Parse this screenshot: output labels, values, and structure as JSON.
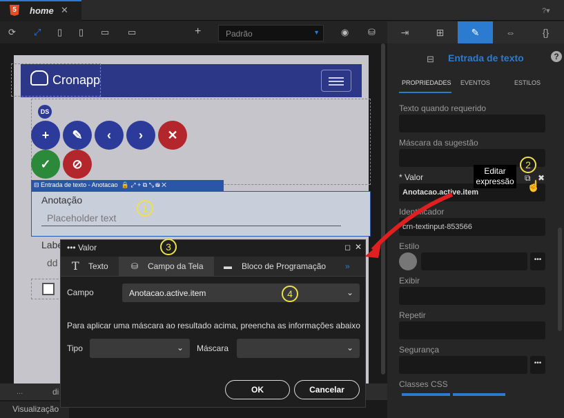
{
  "tab": {
    "title": "home",
    "close": "✕"
  },
  "toolbar": {
    "preset": "Padrão"
  },
  "canvas": {
    "logo_text": "Cronapp",
    "ds_badge": "DS",
    "selected_label": "Entrada de texto - Anotacao",
    "field_label": "Anotação",
    "placeholder": "Placeholder text",
    "bg_label_fragment": "Labe",
    "bg_input_fragment": "dd"
  },
  "bottom": {
    "left": "...",
    "fragment": "di",
    "visualizacao": "Visualização"
  },
  "panel": {
    "title": "Entrada de texto",
    "subtabs": [
      "PROPRIEDADES",
      "EVENTOS",
      "ESTILOS"
    ],
    "fields": {
      "texto_requerido": "Texto quando requerido",
      "mascara_sugestao": "Máscara da sugestão",
      "valor": "* Valor",
      "valor_value": "Anotacao.active.item",
      "identificador": "Identificador",
      "identificador_value": "crn-textinput-853566",
      "estilo": "Estilo",
      "exibir": "Exibir",
      "repetir": "Repetir",
      "seguranca": "Segurança",
      "classes_css": "Classes CSS"
    },
    "tooltip": "Editar expressão"
  },
  "dialog": {
    "title": "Valor",
    "tabs": [
      "Texto",
      "Campo da Tela",
      "Bloco de Programação"
    ],
    "more": "»",
    "campo_label": "Campo",
    "campo_value": "Anotacao.active.item",
    "info": "Para aplicar uma máscara ao resultado acima, preencha as informações abaixo",
    "tipo_label": "Tipo",
    "mascara_label": "Máscara",
    "ok": "OK",
    "cancel": "Cancelar"
  },
  "annotations": [
    "1",
    "2",
    "3",
    "4"
  ],
  "colors": {
    "accent": "#2b7bd1",
    "annotation": "#eee14a",
    "arrow": "#e02020"
  }
}
